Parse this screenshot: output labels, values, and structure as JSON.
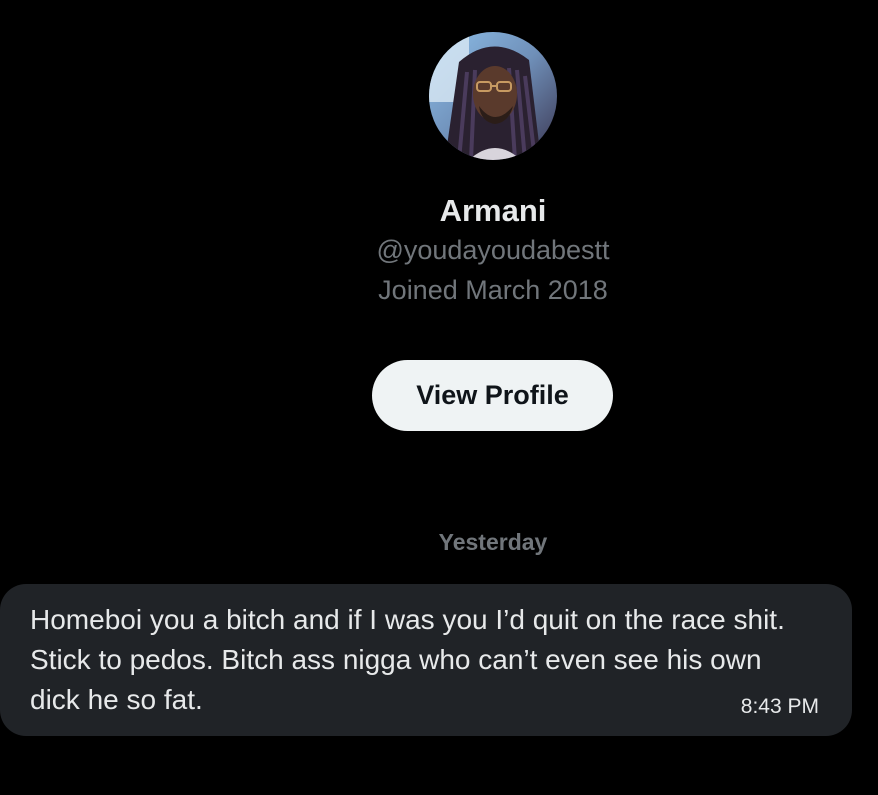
{
  "profile": {
    "display_name": "Armani",
    "handle": "@youdayoudabestt",
    "joined": "Joined March 2018",
    "view_profile_label": "View Profile"
  },
  "conversation": {
    "date_divider": "Yesterday",
    "messages": [
      {
        "text": "Homeboi you a bitch and if I was you I’d quit on the race shit. Stick to pedos. Bitch ass nigga who can’t even see his own dick he so fat.",
        "time": "8:43 PM"
      }
    ]
  },
  "colors": {
    "background": "#000000",
    "primary_text": "#e7e9ea",
    "secondary_text": "#71767b",
    "button_bg": "#eff3f4",
    "button_text": "#0f1419",
    "bubble_bg": "#202327"
  }
}
